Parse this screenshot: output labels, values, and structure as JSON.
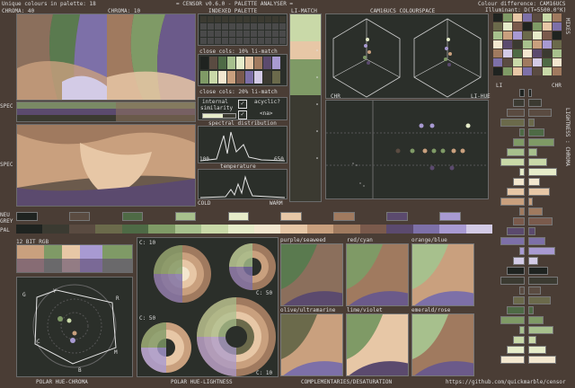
{
  "header": {
    "unique": "Unique colours in palette: 18",
    "title": "= CENSOR v0.6.0 - PALETTE ANALYSER =",
    "diff_line1": "Colour difference: CAM16UCS",
    "diff_line2": "Illuminant: D(T=5500.0°K)"
  },
  "labels": {
    "chroma40": "CHROMA: 40",
    "chroma10": "CHROMA: 10",
    "indexed": "INDEXED PALETTE",
    "limatch_top": "LI-MATCH",
    "cam16": "CAM16UCS COLOURSPACE",
    "close1": "close cols: 10% li-match",
    "close2": "close cols: 20% li-match",
    "internal": "internal",
    "similarity": "similarity",
    "acyclic": "acyclic?",
    "na": "<na>",
    "spectral": "spectral distribution",
    "w100": "100",
    "w650": "650",
    "temperature": "temperature",
    "cold": "COLD",
    "warm": "WARM",
    "spec_cb": "SPEC CB",
    "spec_sb": "SPEC SB",
    "neu": "NEU",
    "grey": "GREY",
    "pal": "PAL",
    "chr_left": "CHR",
    "lihue": "LI-HUE",
    "li": "LI",
    "chr_right": "CHR",
    "vert_label": "LIGHTNESS : CHROMA",
    "vert_mix": "MIXES",
    "bit12": "12 BIT RGB",
    "c10a": "C: 10",
    "c50a": "C: 50",
    "c50b": "C: 50",
    "c10b": "C: 10",
    "polar_hc": "POLAR HUE-CHROMA",
    "polar_hl": "POLAR HUE-LIGHTNESS",
    "compl": "COMPLEMENTARIES/DESATURATION",
    "url": "https://github.com/quickmarble/censor",
    "g": "G",
    "y": "Y",
    "r": "R",
    "c": "C",
    "m": "M",
    "b": "B",
    "ps": "purple/seaweed",
    "rc": "red/cyan",
    "ob": "orange/blue",
    "au": "olive/ultramarine",
    "lv": "lime/violet",
    "er": "emerald/rose"
  },
  "palette": [
    "#1f2320",
    "#3b3a31",
    "#5a4b41",
    "#6b6a4b",
    "#4e6a45",
    "#7f9a66",
    "#a7c08d",
    "#c9d9a8",
    "#e6ecc9",
    "#f3e7cf",
    "#e7c7a6",
    "#c9a07e",
    "#a07a5f",
    "#7a5a4c",
    "#5b4a6e",
    "#7d70a8",
    "#a89ad2",
    "#d3cbe6"
  ],
  "colors": {
    "bg": "#4a3d35",
    "panel": "#2b2f2a",
    "border": "#6b6b6b"
  }
}
